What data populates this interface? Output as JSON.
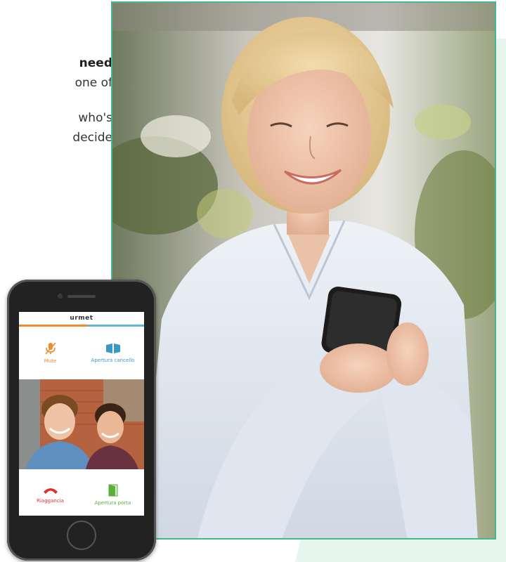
{
  "text_fragment": {
    "line1": "need",
    "line2": "one of",
    "line3": "who's",
    "line4": "decide"
  },
  "phone_app": {
    "brand": "urmet",
    "mute_label": "Mute",
    "gate_label": "Apertura cancello",
    "hangup_label": "Riaggancia",
    "door_label": "Apertura porta",
    "icons": {
      "mute": "microphone-slash-icon",
      "gate": "gate-icon",
      "hangup": "phone-hangup-icon",
      "door": "door-icon"
    },
    "colors": {
      "orange": "#f08a2c",
      "blue": "#3a99c4",
      "red": "#e0322a",
      "green": "#5cae3d"
    }
  }
}
